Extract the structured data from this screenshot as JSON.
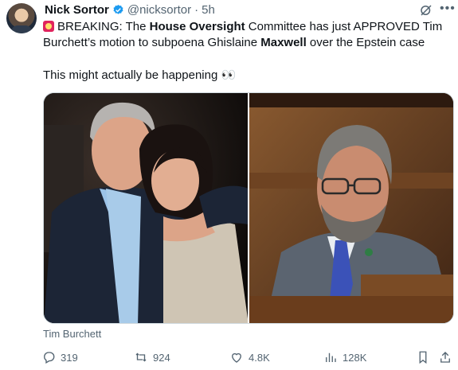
{
  "author": {
    "name": "Nick Sortor",
    "handle": "@nicksortor",
    "separator": "·",
    "time": "5h"
  },
  "tweet": {
    "part1": "BREAKING: The ",
    "bold1": "House Oversight",
    "part2": " Committee has just APPROVED Tim Burchett’s motion to subpoena Ghislaine ",
    "bold2": "Maxwell",
    "part3": " over the Epstein case",
    "line2": "This might actually be happening 👀"
  },
  "media": {
    "caption": "Tim Burchett"
  },
  "actions": {
    "replies": "319",
    "reposts": "924",
    "likes": "4.8K",
    "views": "128K"
  },
  "icons": [
    "avatar",
    "verified-badge-icon",
    "grok-icon",
    "more-icon",
    "siren-emoji",
    "reply-icon",
    "repost-icon",
    "like-icon",
    "views-icon",
    "bookmark-icon",
    "share-icon"
  ],
  "colors": {
    "verified": "#1d9bf0",
    "muted": "#536471",
    "text": "#0f1419"
  }
}
